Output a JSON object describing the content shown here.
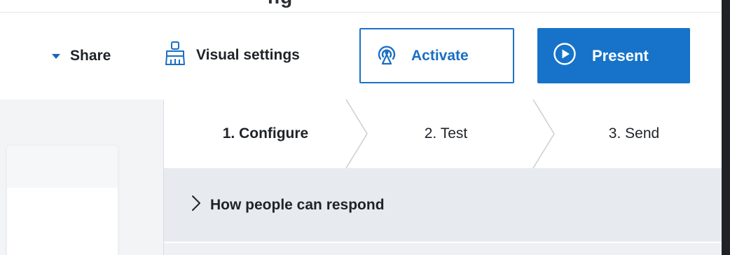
{
  "page_title_fragment": "ng",
  "toolbar": {
    "share_label": "Share",
    "visual_settings_label": "Visual settings",
    "activate_label": "Activate",
    "present_label": "Present"
  },
  "icons": {
    "share": "caret-down-icon",
    "visual_settings": "paint-brush-icon",
    "activate": "broadcast-icon",
    "present": "play-circle-icon",
    "section_toggle": "chevron-right-icon"
  },
  "steps": [
    {
      "label": "1. Configure",
      "active": true
    },
    {
      "label": "2. Test",
      "active": false
    },
    {
      "label": "3. Send",
      "active": false
    }
  ],
  "sections": [
    {
      "label": "How people can respond",
      "expanded": false
    }
  ],
  "colors": {
    "accent": "#1673c9",
    "present_text": "#ffffff",
    "section_bg": "#e7ebf0"
  }
}
